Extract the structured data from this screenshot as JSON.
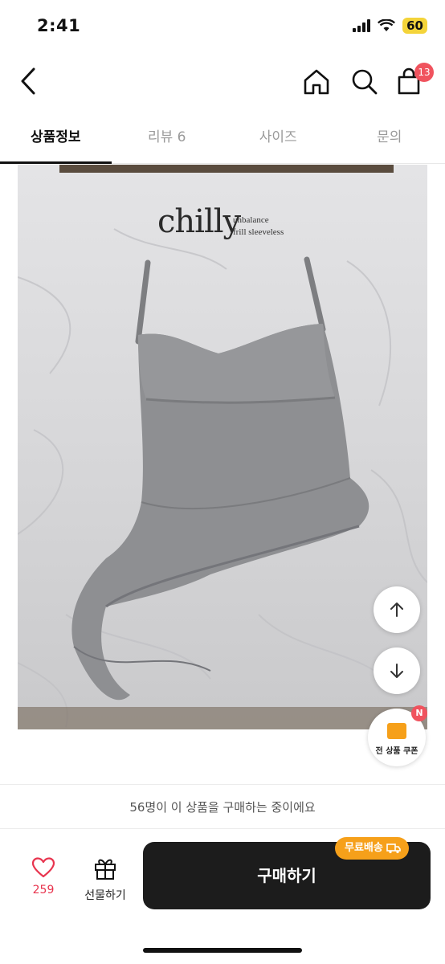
{
  "status": {
    "time": "2:41",
    "battery": "60"
  },
  "header": {
    "cart_count": "13"
  },
  "tabs": [
    {
      "label": "상품정보"
    },
    {
      "label": "리뷰 6"
    },
    {
      "label": "사이즈"
    },
    {
      "label": "문의"
    }
  ],
  "product_image": {
    "brand": "chilly",
    "subtitle_line1": "unbalance",
    "subtitle_line2": "frill sleeveless"
  },
  "coupon": {
    "label": "전 상품 쿠폰",
    "badge": "N"
  },
  "notice": "56명이 이 상품을 구매하는 중이에요",
  "bottom": {
    "like_count": "259",
    "gift_label": "선물하기",
    "buy_label": "구매하기",
    "free_shipping": "무료배송"
  },
  "colors": {
    "accent": "#f6a01a",
    "badge": "#f0535e",
    "buy_button": "#1c1c1c",
    "like": "#e8344e"
  }
}
